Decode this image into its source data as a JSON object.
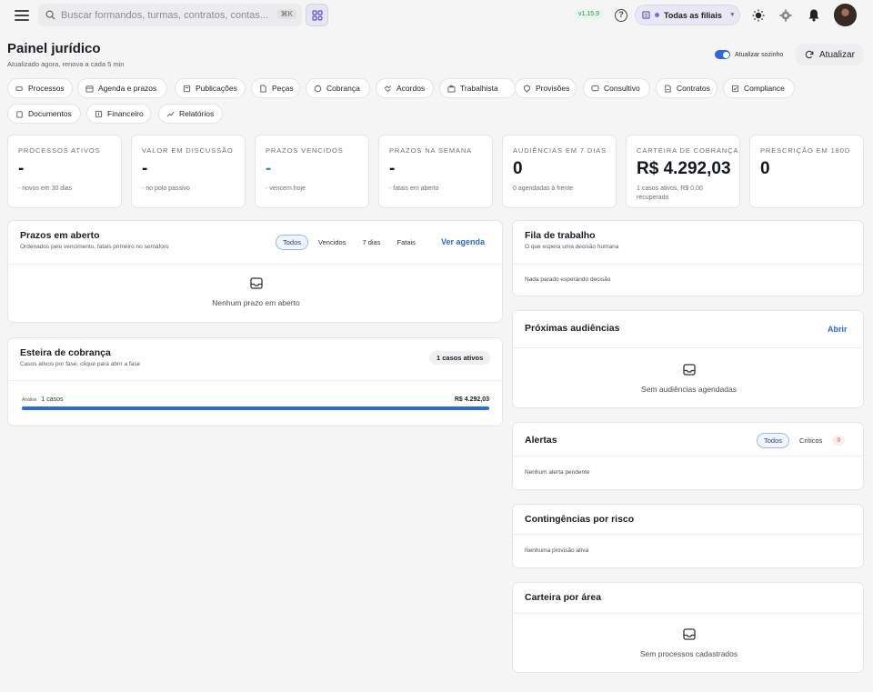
{
  "topbar": {
    "search_placeholder": "Buscar formandos, turmas, contratos, contas...",
    "search_shortcut": "⌘K",
    "version": "v1.15.9",
    "branch_label": "Todas as filiais"
  },
  "header": {
    "title": "Painel jurídico",
    "subtitle": "Atualizado agora, renova a cada 5 min",
    "auto_update_label": "Atualizar sozinho",
    "auto_update_on": true,
    "refresh_label": "Atualizar"
  },
  "tabs": [
    {
      "label": "Processos",
      "icon": "gavel-icon"
    },
    {
      "label": "Agenda e prazos",
      "icon": "calendar-icon"
    },
    {
      "label": "Publicações",
      "icon": "newspaper-icon"
    },
    {
      "label": "Peças",
      "icon": "document-icon"
    },
    {
      "label": "Cobrança",
      "icon": "money-icon"
    },
    {
      "label": "Acordos",
      "icon": "handshake-icon"
    },
    {
      "label": "Trabalhista",
      "icon": "briefcase-icon"
    },
    {
      "label": "Provisões",
      "icon": "shield-icon"
    },
    {
      "label": "Consultivo",
      "icon": "chat-icon"
    },
    {
      "label": "Contratos",
      "icon": "contract-icon"
    },
    {
      "label": "Compliance",
      "icon": "checklist-icon"
    },
    {
      "label": "Documentos",
      "icon": "files-icon"
    },
    {
      "label": "Financeiro",
      "icon": "finance-icon"
    },
    {
      "label": "Relatórios",
      "icon": "chart-icon"
    }
  ],
  "kpis": [
    {
      "label": "Processos ativos",
      "value": "-",
      "sub": "- novos em 30 dias"
    },
    {
      "label": "Valor em discussão",
      "value": "-",
      "sub": "- no polo passivo"
    },
    {
      "label": "Prazos vencidos",
      "value": "-",
      "sub": "- vencem hoje"
    },
    {
      "label": "Prazos na semana",
      "value": "-",
      "sub": "- fatais em aberto"
    },
    {
      "label": "Audiências em 7 dias",
      "value": "0",
      "sub": "0 agendadas à frente"
    },
    {
      "label": "Carteira de cobrança",
      "value": "R$ 4.292,03",
      "sub": "1 casos ativos, R$ 0,00 recuperado"
    },
    {
      "label": "Prescrição em 180d",
      "value": "0",
      "sub": ""
    }
  ],
  "colors": {
    "accent": "#2e6bd6",
    "green": "#2f9e6a"
  },
  "prazos": {
    "title": "Prazos em aberto",
    "subtitle": "Ordenados pelo vencimento, fatais primeiro no semáforo",
    "filters": [
      "Todos",
      "Vencidos",
      "7 dias",
      "Fatais"
    ],
    "active_filter": "Todos",
    "agenda_link": "Ver agenda",
    "empty": "Nenhum prazo em aberto"
  },
  "fila": {
    "title": "Fila de trabalho",
    "subtitle": "O que espera uma decisão humana",
    "empty": "Nada parado esperando decisão"
  },
  "esteira": {
    "title": "Esteira de cobrança",
    "subtitle": "Casos ativos por fase, clique para abrir a fase",
    "badge": "1 casos ativos",
    "stage_label": "Análise",
    "stage_count": "1 casos",
    "stage_value": "R$ 4.292,03",
    "stage_fill": 1.0
  },
  "audiencias": {
    "title": "Próximas audiências",
    "open_label": "Abrir",
    "empty": "Sem audiências agendadas"
  },
  "alertas": {
    "title": "Alertas",
    "filters": [
      "Todos",
      "Críticos"
    ],
    "active_filter": "Todos",
    "critical_count": "0",
    "empty": "Nenhum alerta pendente"
  },
  "contingencias": {
    "title": "Contingências por risco",
    "empty": "Nenhuma provisão ativa"
  },
  "carteira": {
    "title": "Carteira por área",
    "empty": "Sem processos cadastrados"
  }
}
